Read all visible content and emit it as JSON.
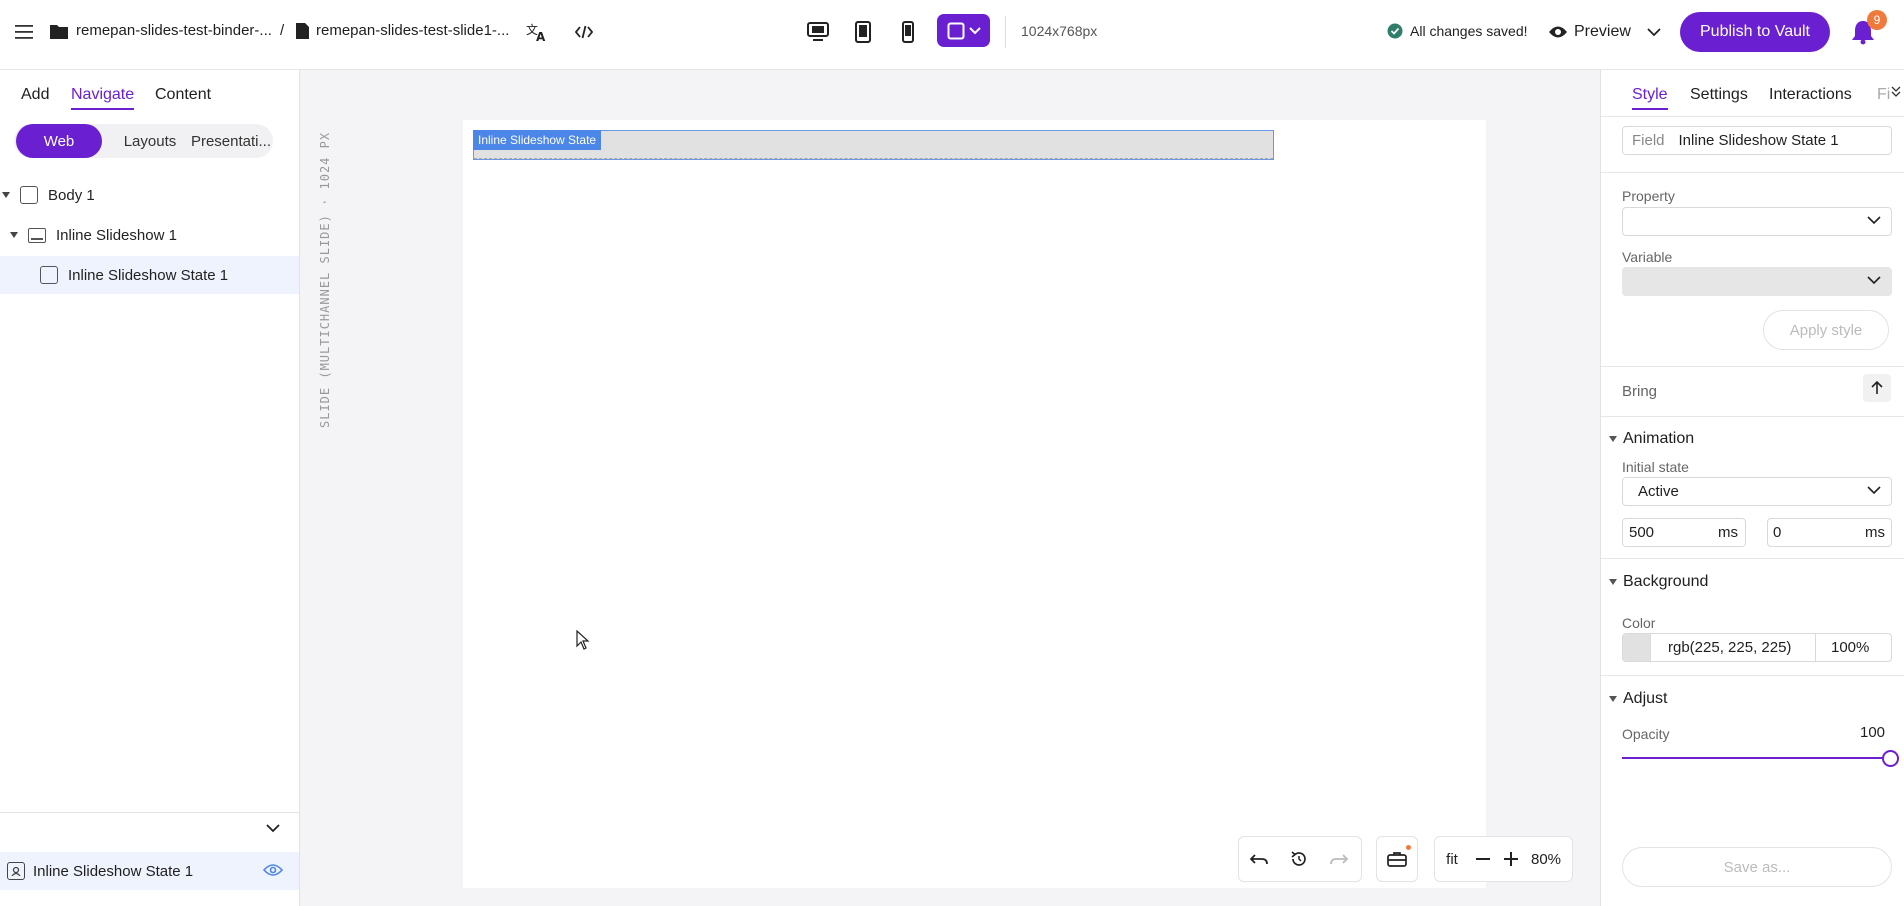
{
  "topbar": {
    "breadcrumb_binder": "remepan-slides-test-binder-...",
    "breadcrumb_sep": "/",
    "breadcrumb_slide": "remepan-slides-test-slide1-...",
    "dimensions": "1024x768px",
    "save_status": "All changes saved!",
    "preview_label": "Preview",
    "publish_label": "Publish to Vault",
    "notification_count": "9"
  },
  "left_panel": {
    "tabs": [
      "Add",
      "Navigate",
      "Content"
    ],
    "active_tab": "Navigate",
    "segments": [
      "Web",
      "Layouts",
      "Presentati..."
    ],
    "active_segment": "Web",
    "tree": [
      {
        "label": "Body 1"
      },
      {
        "label": "Inline Slideshow 1"
      },
      {
        "label": "Inline Slideshow State 1"
      }
    ],
    "selected_item": "Inline Slideshow State 1"
  },
  "canvas": {
    "vertical_label": "SLIDE (MULTICHANNEL SLIDE) · 1024 PX",
    "state_tag": "Inline Slideshow State",
    "zoom_fit": "fit",
    "zoom_level": "80%"
  },
  "right_panel": {
    "tabs": [
      "Style",
      "Settings",
      "Interactions",
      "Fi"
    ],
    "active_tab": "Style",
    "field_label": "Field",
    "field_value": "Inline Slideshow State 1",
    "property_label": "Property",
    "variable_label": "Variable",
    "apply_style_label": "Apply style",
    "bring_label": "Bring",
    "animation_title": "Animation",
    "initial_state_label": "Initial state",
    "initial_state_value": "Active",
    "duration_value": "500",
    "duration_unit": "ms",
    "delay_value": "0",
    "delay_unit": "ms",
    "background_title": "Background",
    "color_label": "Color",
    "color_value": "rgb(225, 225, 225)",
    "color_opacity": "100%",
    "adjust_title": "Adjust",
    "opacity_label": "Opacity",
    "opacity_value": "100",
    "save_as_label": "Save as..."
  },
  "colors": {
    "accent": "#6a1fd1",
    "selection_blue": "#4b86e8",
    "badge": "#f07a3c",
    "saved_check": "#2f7d6b",
    "state_fill": "#e1e1e1"
  }
}
